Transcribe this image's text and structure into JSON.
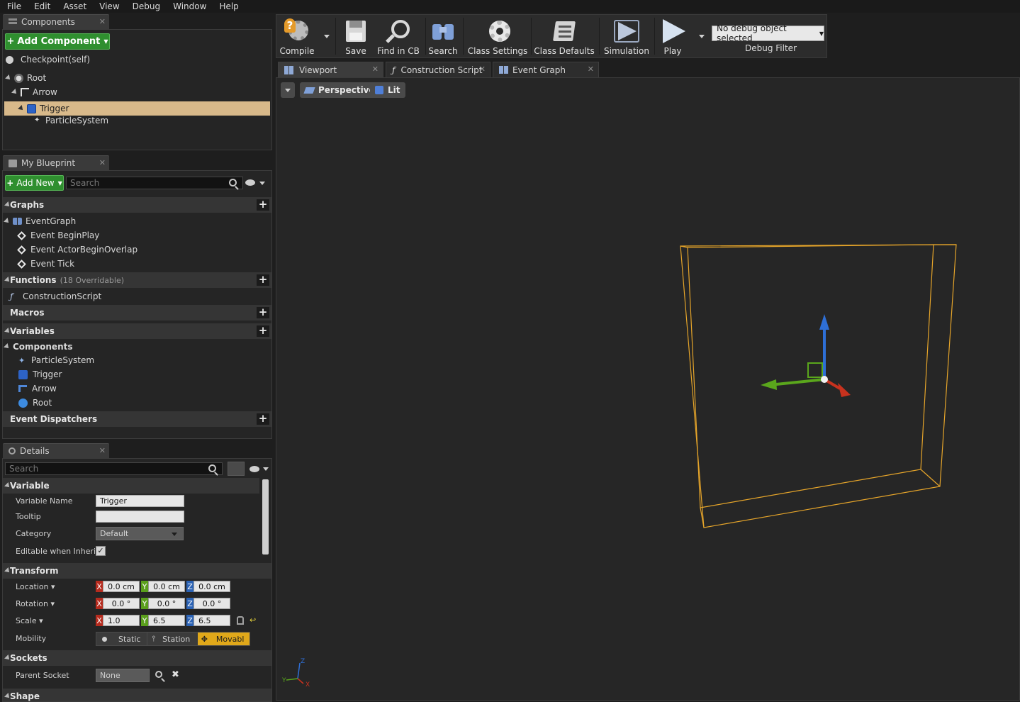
{
  "menu": [
    "File",
    "Edit",
    "Asset",
    "View",
    "Debug",
    "Window",
    "Help"
  ],
  "components_panel": {
    "tab_label": "Components",
    "add_button": "Add Component",
    "self_label": "Checkpoint(self)",
    "tree": [
      {
        "label": "Root",
        "depth": 0
      },
      {
        "label": "Arrow",
        "depth": 1
      },
      {
        "label": "Trigger",
        "depth": 2,
        "selected": true
      },
      {
        "label": "ParticleSystem",
        "depth": 3
      }
    ]
  },
  "my_blueprint": {
    "tab_label": "My Blueprint",
    "add_button": "Add New",
    "search_placeholder": "Search",
    "graphs_header": "Graphs",
    "event_graph": "EventGraph",
    "events": [
      "Event BeginPlay",
      "Event ActorBeginOverlap",
      "Event Tick"
    ],
    "functions_header": "Functions",
    "functions_sub": "(18 Overridable)",
    "construction_script": "ConstructionScript",
    "macros_header": "Macros",
    "variables_header": "Variables",
    "components_header": "Components",
    "component_vars": [
      "ParticleSystem",
      "Trigger",
      "Arrow",
      "Root"
    ],
    "dispatchers_header": "Event Dispatchers"
  },
  "details": {
    "tab_label": "Details",
    "search_placeholder": "Search",
    "variable_header": "Variable",
    "variable_name_label": "Variable Name",
    "variable_name_value": "Trigger",
    "tooltip_label": "Tooltip",
    "tooltip_value": "",
    "category_label": "Category",
    "category_value": "Default",
    "editable_label": "Editable when Inherite",
    "editable_checked": true,
    "transform_header": "Transform",
    "location_label": "Location",
    "location": {
      "x": "0.0 cm",
      "y": "0.0 cm",
      "z": "0.0 cm"
    },
    "rotation_label": "Rotation",
    "rotation": {
      "x": "0.0 °",
      "y": "0.0 °",
      "z": "0.0 °"
    },
    "scale_label": "Scale",
    "scale": {
      "x": "1.0",
      "y": "6.5",
      "z": "6.5"
    },
    "mobility_label": "Mobility",
    "mobility_options": [
      "Static",
      "Station",
      "Movabl"
    ],
    "mobility_selected": "Movabl",
    "sockets_header": "Sockets",
    "parent_socket_label": "Parent Socket",
    "parent_socket_value": "None",
    "shape_header": "Shape"
  },
  "toolbar": {
    "compile": "Compile",
    "save": "Save",
    "find_in_cb": "Find in CB",
    "search": "Search",
    "class_settings": "Class Settings",
    "class_defaults": "Class Defaults",
    "simulation": "Simulation",
    "play": "Play",
    "debug_object": "No debug object selected",
    "debug_filter": "Debug Filter"
  },
  "doc_tabs": [
    "Viewport",
    "Construction Script",
    "Event Graph"
  ],
  "viewport": {
    "perspective": "Perspective",
    "lit": "Lit",
    "axis_labels": {
      "x": "X",
      "y": "Y",
      "z": "Z"
    }
  },
  "colors": {
    "accent_green": "#2f8f2f",
    "selection": "#d8b98a",
    "trigger_box": "#e6a52a",
    "axis_x": "#c8321e",
    "axis_y": "#5aa61c",
    "axis_z": "#2e6fd6",
    "mobility_selected": "#e0a81a"
  }
}
